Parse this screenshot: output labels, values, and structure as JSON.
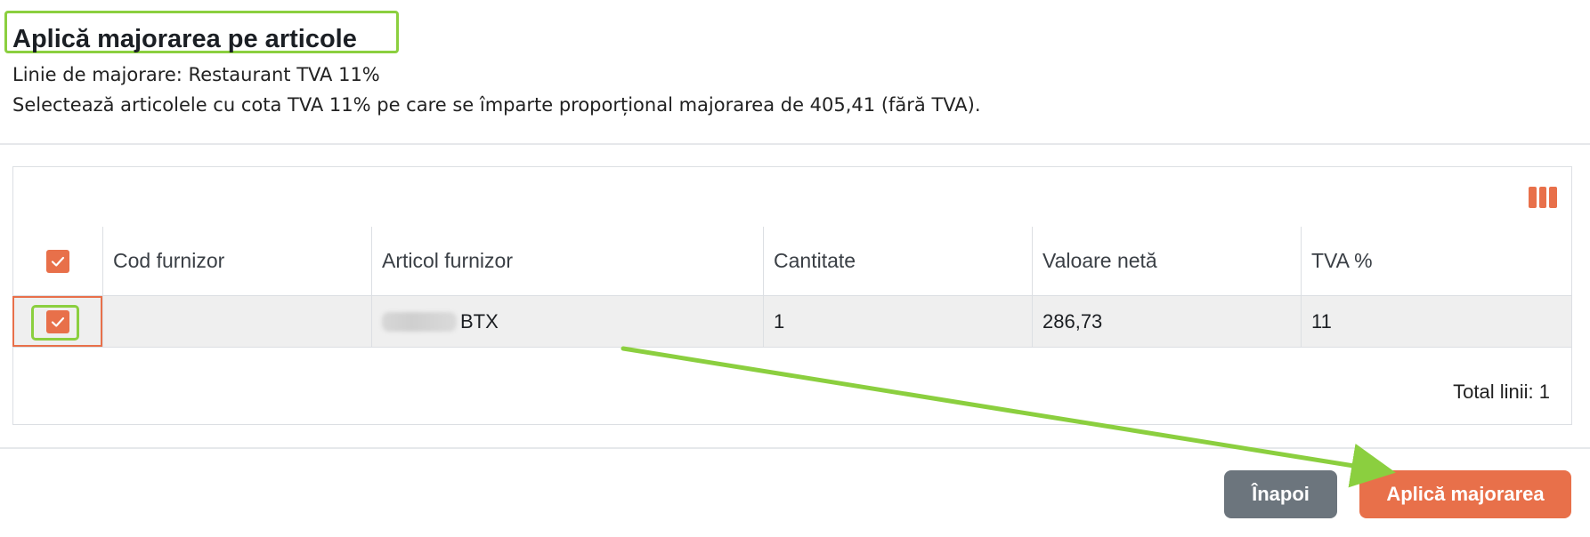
{
  "dialog": {
    "title": "Aplică majorarea pe articole",
    "info_line": "Linie de majorare: Restaurant TVA 11%",
    "instruction": "Selectează articolele cu cota TVA 11% pe care se împarte proporțional majorarea de 405,41 (fără TVA)."
  },
  "table": {
    "toolbar_icon": "columns-icon",
    "columns": [
      "Cod furnizor",
      "Articol furnizor",
      "Cantitate",
      "Valoare netă",
      "TVA %"
    ],
    "rows": [
      {
        "selected": true,
        "cod_furnizor": "",
        "articol_furnizor": "BTX",
        "cantitate": "1",
        "valoare_neta": "286,73",
        "tva": "11"
      }
    ],
    "footer_total": "Total linii: 1"
  },
  "buttons": {
    "back": "Înapoi",
    "apply": "Aplică majorarea"
  },
  "colors": {
    "accent": "#e8704a",
    "secondary_button": "#6c757d",
    "annotation": "#8bcf3f"
  }
}
